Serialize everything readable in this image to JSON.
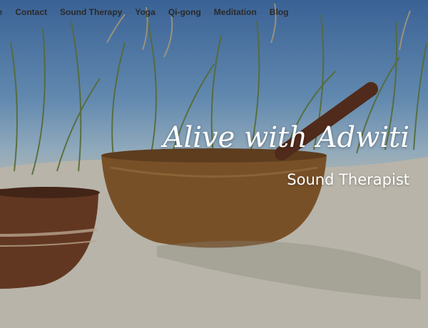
{
  "nav": {
    "items": [
      {
        "label": "me"
      },
      {
        "label": "Contact"
      },
      {
        "label": "Sound Therapy"
      },
      {
        "label": "Yoga"
      },
      {
        "label": "Qi-gong"
      },
      {
        "label": "Meditation"
      },
      {
        "label": "Blog"
      }
    ]
  },
  "hero": {
    "title": "Alive with Adwiti",
    "subtitle": "Sound Therapist"
  },
  "colors": {
    "nav_text": "#2a2a2a",
    "hero_text": "#ffffff"
  }
}
